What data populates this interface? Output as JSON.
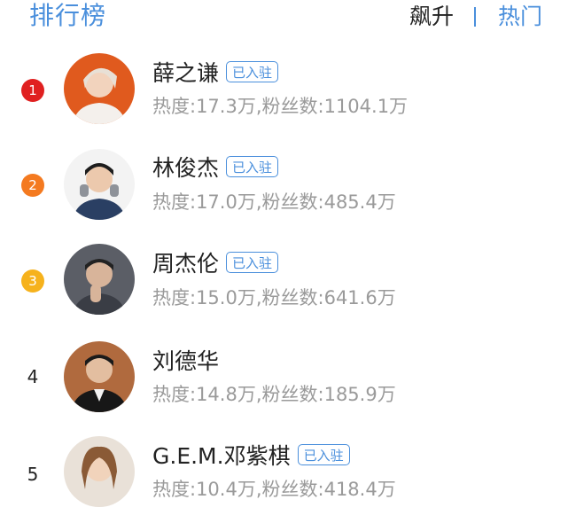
{
  "header": {
    "title": "排行榜",
    "tab_rising": "飙升",
    "tab_hot": "热门",
    "accent_color": "#4a8fdc"
  },
  "rank_colors": {
    "1": "#e02020",
    "2": "#f47a20",
    "3": "#f6b21c"
  },
  "entries": [
    {
      "rank": "1",
      "name": "薛之谦",
      "verified": "已入驻",
      "stats": "热度:17.3万,粉丝数:1104.1万",
      "avatar_icon": "avatar-photo"
    },
    {
      "rank": "2",
      "name": "林俊杰",
      "verified": "已入驻",
      "stats": "热度:17.0万,粉丝数:485.4万",
      "avatar_icon": "avatar-photo"
    },
    {
      "rank": "3",
      "name": "周杰伦",
      "verified": "已入驻",
      "stats": "热度:15.0万,粉丝数:641.6万",
      "avatar_icon": "avatar-photo"
    },
    {
      "rank": "4",
      "name": "刘德华",
      "verified": "",
      "stats": "热度:14.8万,粉丝数:185.9万",
      "avatar_icon": "avatar-photo"
    },
    {
      "rank": "5",
      "name": "G.E.M.邓紫棋",
      "verified": "已入驻",
      "stats": "热度:10.4万,粉丝数:418.4万",
      "avatar_icon": "avatar-photo"
    }
  ]
}
